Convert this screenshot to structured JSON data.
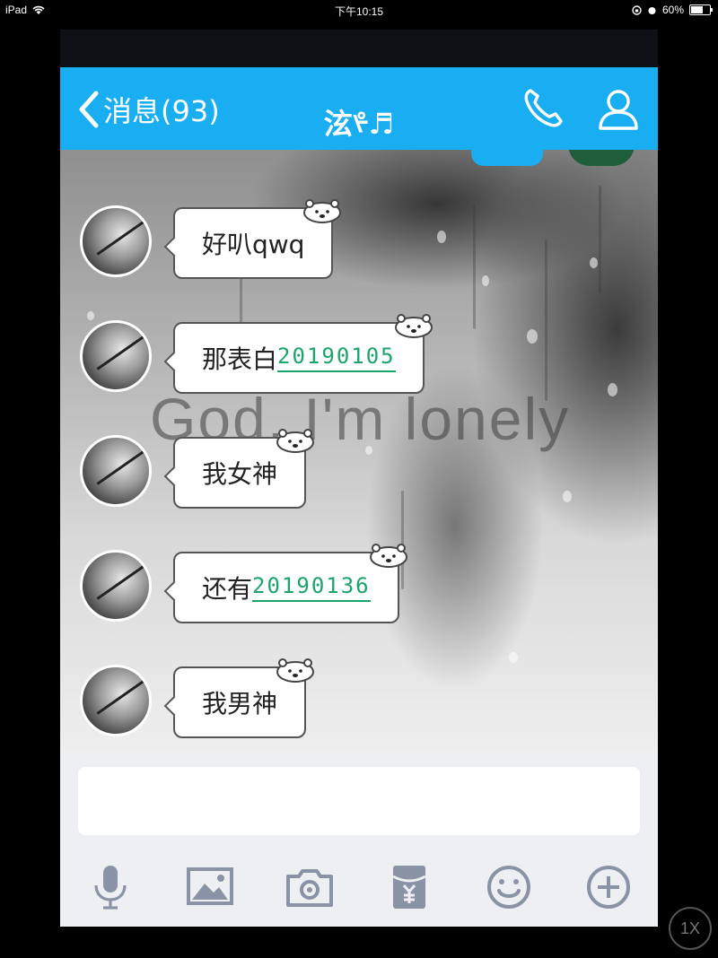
{
  "status_bar": {
    "device": "iPad",
    "time": "下午10:15",
    "battery": "60%"
  },
  "nav": {
    "back_label": "消息(93)",
    "title": "泫ᢞ♬"
  },
  "chat": {
    "overlay_text": "God, I'm lonely",
    "messages": [
      {
        "text": "好叭qwq",
        "link": ""
      },
      {
        "text": "那表白",
        "link": "20190105"
      },
      {
        "text": "我女神",
        "link": ""
      },
      {
        "text": "还有",
        "link": "20190136"
      },
      {
        "text": "我男神",
        "link": ""
      }
    ]
  },
  "composer": {
    "input_value": ""
  },
  "player": {
    "speed": "1X"
  },
  "colors": {
    "accent": "#19aef2",
    "link": "#1aa56b",
    "icon": "#8a92a6"
  }
}
